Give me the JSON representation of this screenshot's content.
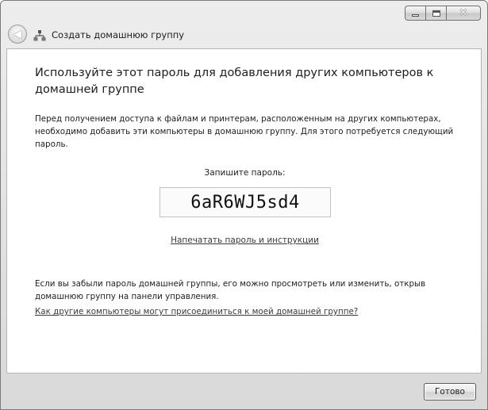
{
  "window": {
    "title": "Создать домашнюю группу"
  },
  "icons": {
    "back": "back-arrow-icon",
    "app": "homegroup-network-icon",
    "minimize": "minimize-icon",
    "maximize": "maximize-icon",
    "close": "close-icon"
  },
  "content": {
    "heading": "Используйте этот пароль для добавления других компьютеров к домашней группе",
    "description": "Перед получением доступа к файлам и принтерам, расположенным на других компьютерах, необходимо добавить эти компьютеры в домашнюю группу. Для этого потребуется следующий пароль.",
    "password_label": "Запишите пароль:",
    "password": "6aR6WJ5sd4",
    "print_link": "Напечатать пароль и инструкции",
    "forgot_text": "Если вы забыли пароль домашней группы, его можно просмотреть или изменить, открыв домашнюю группу на панели управления.",
    "help_link": "Как другие компьютеры могут присоединиться к моей домашней группе?"
  },
  "footer": {
    "done_label": "Готово"
  }
}
